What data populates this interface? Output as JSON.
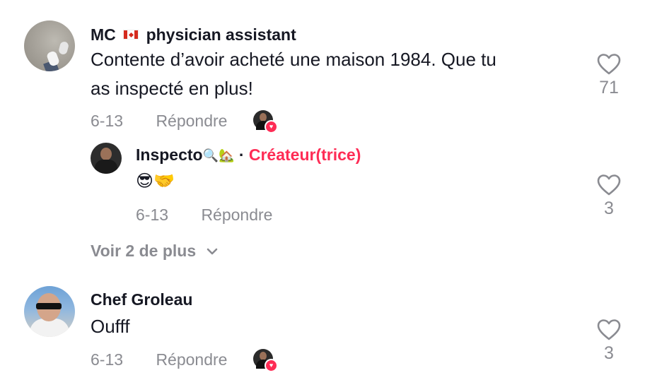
{
  "comments": [
    {
      "username": "MC",
      "username_suffix": "physician assistant",
      "text_line1": "Contente d’avoir acheté une maison 1984. Que tu",
      "text_line2": "as inspecté en plus!",
      "date": "6-13",
      "reply_label": "Répondre",
      "likes": "71",
      "liked_by_creator": true
    },
    {
      "username": "Inspecto",
      "creator_label": "Créateur(trice)",
      "separator": "·",
      "text": "😎🤝",
      "date": "6-13",
      "reply_label": "Répondre",
      "likes": "3"
    },
    {
      "username": "Chef Groleau",
      "text": "Oufff",
      "date": "6-13",
      "reply_label": "Répondre",
      "likes": "3",
      "liked_by_creator": true
    }
  ],
  "view_more_label": "Voir 2 de plus",
  "icons": {
    "flag": "canada-flag-icon",
    "username_emojis": [
      "magnifier-icon",
      "house-icon"
    ],
    "like": "heart-outline-icon",
    "chevron": "chevron-down-icon",
    "creator_heart": "heart-badge-icon"
  },
  "colors": {
    "accent": "#fe2c55",
    "muted": "#8a8b91",
    "text": "#161823"
  }
}
